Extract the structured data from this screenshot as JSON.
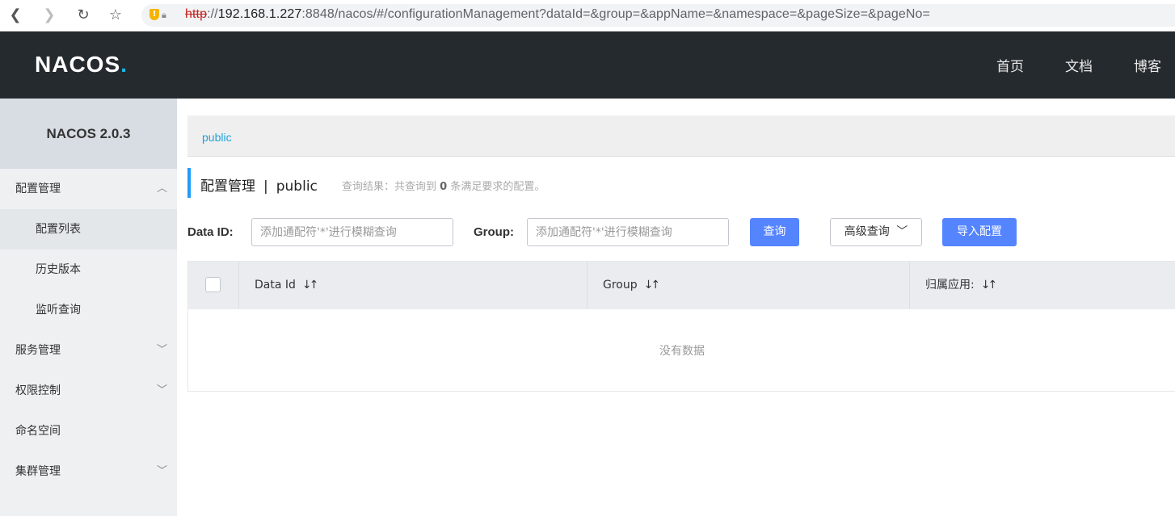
{
  "browser": {
    "url_scheme": "http",
    "url_host": "192.168.1.227",
    "url_rest": ":8848/nacos/#/configurationManagement?dataId=&group=&appName=&namespace=&pageSize=&pageNo="
  },
  "header": {
    "logo_main": "NACOS",
    "logo_dot": ".",
    "nav": [
      "首页",
      "文档",
      "博客"
    ]
  },
  "sidebar": {
    "title": "NACOS 2.0.3",
    "items": [
      {
        "label": "配置管理"
      },
      {
        "label": "配置列表"
      },
      {
        "label": "历史版本"
      },
      {
        "label": "监听查询"
      },
      {
        "label": "服务管理"
      },
      {
        "label": "权限控制"
      },
      {
        "label": "命名空间"
      },
      {
        "label": "集群管理"
      }
    ]
  },
  "breadcrumb": {
    "namespace": "public"
  },
  "page": {
    "title": "配置管理",
    "separator": "|",
    "namespace": "public",
    "summary_prefix": "查询结果：共查询到",
    "summary_count": "0",
    "summary_suffix": "条满足要求的配置。"
  },
  "filters": {
    "dataid_label": "Data ID:",
    "dataid_placeholder": "添加通配符'*'进行模糊查询",
    "group_label": "Group:",
    "group_placeholder": "添加通配符'*'进行模糊查询",
    "query_button": "查询",
    "advanced_button": "高级查询",
    "import_button": "导入配置"
  },
  "table": {
    "columns": [
      "Data Id",
      "Group",
      "归属应用:"
    ],
    "empty_text": "没有数据"
  },
  "colors": {
    "header_bg": "#252a2f",
    "primary": "#5584ff",
    "accent_bar": "#209bfa",
    "link": "#1ea3d9"
  }
}
